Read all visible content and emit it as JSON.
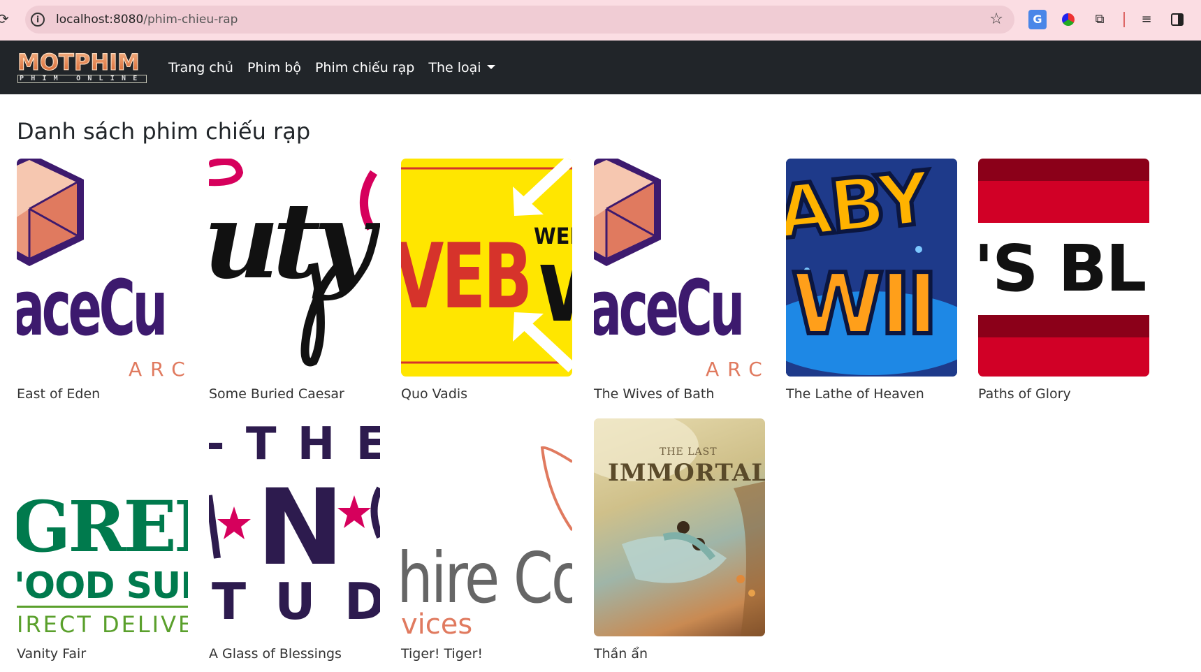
{
  "browser": {
    "url_host": "localhost:8080",
    "url_path": "/phim-chieu-rap",
    "extensions": [
      "google-translate-icon",
      "color-picker-icon",
      "puzzle-extensions-icon",
      "reading-list-icon",
      "side-panel-icon"
    ]
  },
  "navbar": {
    "logo_text": "MOTPHIM",
    "logo_subtext": "PHIM ONLINE",
    "links": [
      {
        "label": "Trang chủ"
      },
      {
        "label": "Phim bộ"
      },
      {
        "label": "Phim chiếu rạp"
      },
      {
        "label": "The loại"
      }
    ]
  },
  "page": {
    "heading": "Danh sách phim chiếu rạp"
  },
  "movies": [
    {
      "title": "East of Eden",
      "poster_text": "aceCu",
      "poster_sub": "ARC"
    },
    {
      "title": "Some Buried Caesar",
      "poster_text": "uty"
    },
    {
      "title": "Quo Vadis",
      "poster_text": "VEB",
      "poster_sub": "WEB"
    },
    {
      "title": "The Wives of Bath",
      "poster_text": "aceCu",
      "poster_sub": "ARC"
    },
    {
      "title": "The Lathe of Heaven",
      "poster_text": "ABY",
      "poster_sub": "WII"
    },
    {
      "title": "Paths of Glory",
      "poster_text": "'S BL"
    },
    {
      "title": "Vanity Fair",
      "poster_text": "GREI",
      "poster_sub": "'OOD SUP",
      "poster_sub2": "IRECT DELIVE"
    },
    {
      "title": "A Glass of Blessings",
      "poster_text": "- T H E -",
      "poster_sub": "N",
      "poster_sub2": "T U D I"
    },
    {
      "title": "Tiger! Tiger!",
      "poster_text": "hire Co",
      "poster_sub": "vices"
    },
    {
      "title": "Thần ẩn",
      "poster_text": "THE LAST",
      "poster_sub": "IMMORTAL"
    }
  ],
  "colors": {
    "navbar_bg": "#212529",
    "chrome_bg": "#fbdde3",
    "purple": "#3d1a6e",
    "coral": "#e07a5f"
  }
}
